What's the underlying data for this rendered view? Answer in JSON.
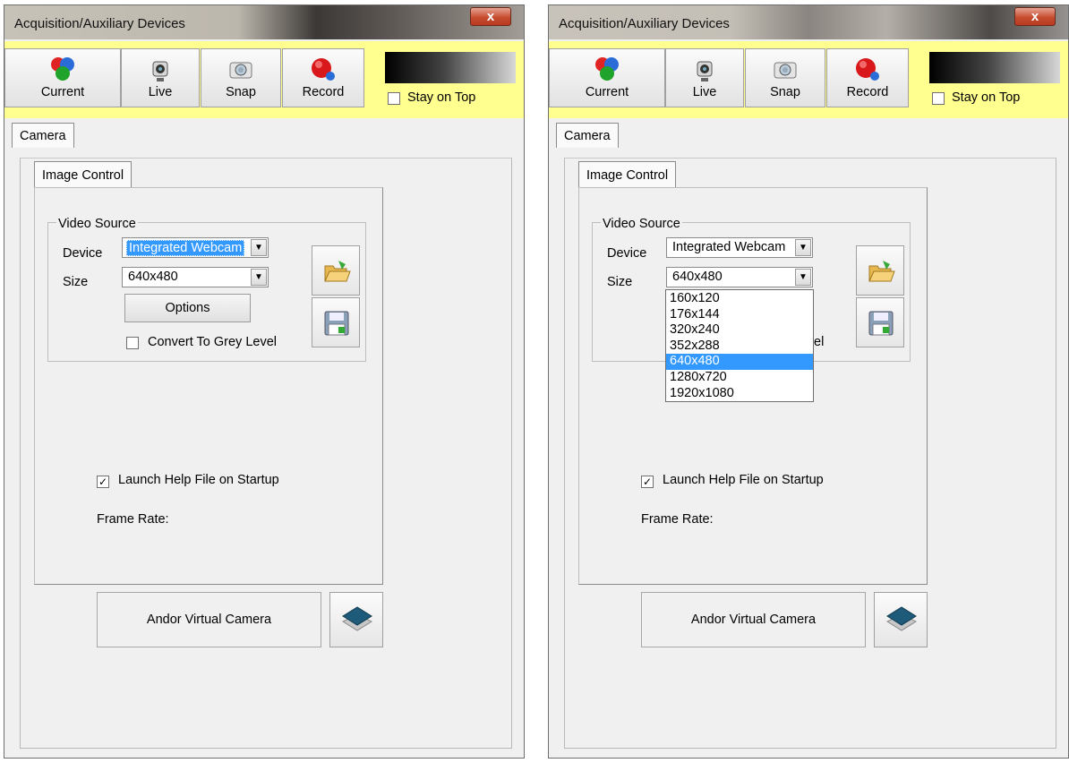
{
  "windows": [
    {
      "title": "Acquisition/Auxiliary Devices",
      "close_label": "x",
      "toolbar": {
        "current_label": "Current",
        "live_label": "Live",
        "snap_label": "Snap",
        "record_label": "Record",
        "stay_on_top_label": "Stay on Top"
      },
      "tabs": {
        "camera": "Camera",
        "image_control": "Image Control"
      },
      "video_source": {
        "legend": "Video Source",
        "device_label": "Device",
        "device_value": "Integrated Webcam",
        "size_label": "Size",
        "size_value": "640x480",
        "options_label": "Options",
        "grey_label": "Convert To Grey Level"
      },
      "help_label": "Launch Help File on Startup",
      "frame_rate_label": "Frame Rate:",
      "andor_label": "Andor Virtual Camera"
    },
    {
      "title": "Acquisition/Auxiliary Devices",
      "close_label": "x",
      "toolbar": {
        "current_label": "Current",
        "live_label": "Live",
        "snap_label": "Snap",
        "record_label": "Record",
        "stay_on_top_label": "Stay on Top"
      },
      "tabs": {
        "camera": "Camera",
        "image_control": "Image Control"
      },
      "video_source": {
        "legend": "Video Source",
        "device_label": "Device",
        "device_value": "Integrated Webcam",
        "size_label": "Size",
        "size_value": "640x480",
        "partial_text": "el"
      },
      "size_options": [
        "160x120",
        "176x144",
        "320x240",
        "352x288",
        "640x480",
        "1280x720",
        "1920x1080"
      ],
      "help_label": "Launch Help File on Startup",
      "frame_rate_label": "Frame Rate:",
      "andor_label": "Andor Virtual Camera"
    }
  ],
  "checkbox_state": {
    "stay_on_top": false,
    "convert_to_grey": false,
    "launch_help": true
  },
  "selected_size_index": 4,
  "colors": {
    "toolbar_bg": "#ffff90",
    "selection": "#3399ff",
    "window_bg": "#f0f0f0"
  },
  "icons": [
    "rgb-circles-icon",
    "webcam-icon",
    "camera-icon",
    "record-icon",
    "folder-open-icon",
    "save-icon",
    "layers-icon"
  ]
}
